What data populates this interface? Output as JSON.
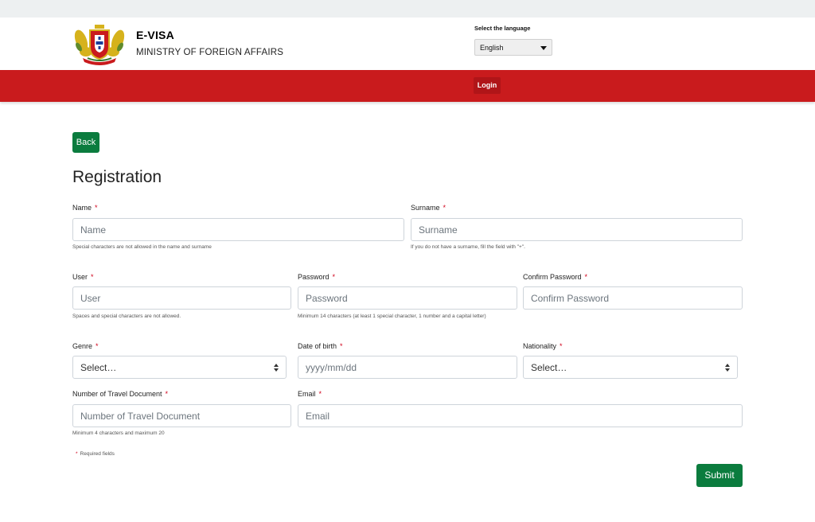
{
  "header": {
    "brand_title": "E-VISA",
    "brand_subtitle": "MINISTRY OF FOREIGN AFFAIRS",
    "language_label": "Select the language",
    "language_selected": "English",
    "logo_icon": "coat-of-arms-icon"
  },
  "nav": {
    "login_label": "Login"
  },
  "page": {
    "back_label": "Back",
    "title": "Registration",
    "required_marker": "*",
    "required_note": "Required fields",
    "submit_label": "Submit"
  },
  "fields": {
    "name": {
      "label": "Name",
      "placeholder": "Name",
      "help": "Special characters are not allowed in the name and surname"
    },
    "surname": {
      "label": "Surname",
      "placeholder": "Surname",
      "help": "If you do not have a surname, fill the field with \"+\"."
    },
    "user": {
      "label": "User",
      "placeholder": "User",
      "help": "Spaces and special characters are not allowed."
    },
    "password": {
      "label": "Password",
      "placeholder": "Password",
      "help": "Minimum 14 characters (at least 1 special character, 1 number and a capital letter)"
    },
    "confirm_password": {
      "label": "Confirm Password",
      "placeholder": "Confirm Password"
    },
    "genre": {
      "label": "Genre",
      "value": "Select…"
    },
    "date_of_birth": {
      "label": "Date of birth",
      "placeholder": "yyyy/mm/dd"
    },
    "nationality": {
      "label": "Nationality",
      "value": "Select…"
    },
    "travel_document": {
      "label": "Number of Travel Document",
      "placeholder": "Number of Travel Document",
      "help": "Minimum 4 characters and maximum 20"
    },
    "email": {
      "label": "Email",
      "placeholder": "Email"
    }
  },
  "colors": {
    "brand_red": "#c91b1d",
    "login_red": "#b01518",
    "button_green": "#0b7c3e",
    "required_red": "#d0021b"
  }
}
